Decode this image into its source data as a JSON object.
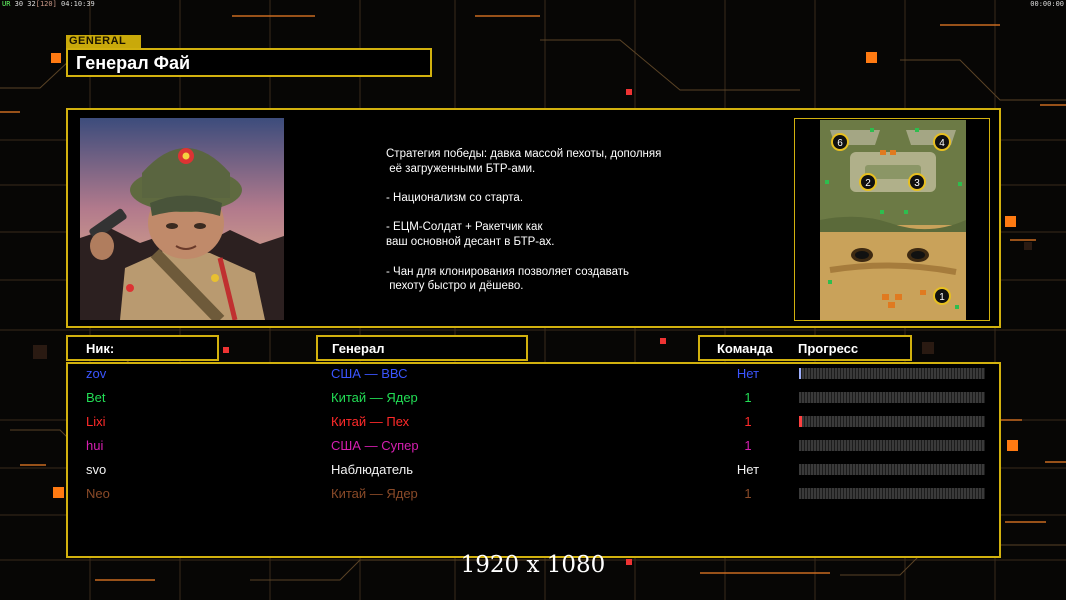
{
  "hud": {
    "left_prefix": "UR",
    "left_fps": "30 32",
    "left_bracket": "[120]",
    "left_time": "04:10:39",
    "right_time": "00:00:00"
  },
  "general": {
    "tag": "GENERAL",
    "name": "Генерал Фай"
  },
  "strategy_lines": [
    "Стратегия победы: давка массой пехоты, дополняя",
    " её загруженными БТР-ами.",
    "",
    "- Национализм со старта.",
    "",
    "- ЕЦМ-Солдат + Ракетчик как",
    "ваш основной десант в БТР-ах.",
    "",
    "- Чан для клонирования позволяет создавать",
    " пехоту быстро и дёшево."
  ],
  "minimap": {
    "start_positions": [
      "6",
      "4",
      "2",
      "3",
      "1"
    ]
  },
  "headers": {
    "nick": "Ник:",
    "general": "Генерал",
    "team": "Команда",
    "progress": "Прогресс"
  },
  "players": [
    {
      "nick": "zov",
      "general": "США — ВВС",
      "team": "Нет",
      "color": "#3b55ff",
      "progress": 0.01,
      "progress_color": "#9fb0ff"
    },
    {
      "nick": "Bet",
      "general": "Китай — Ядер",
      "team": "1",
      "color": "#22dd55",
      "progress": 0.0,
      "progress_color": "#22dd55"
    },
    {
      "nick": "Lixi",
      "general": "Китай — Пех",
      "team": "1",
      "color": "#ff2a2a",
      "progress": 0.015,
      "progress_color": "#ff4040"
    },
    {
      "nick": "hui",
      "general": "США — Супер",
      "team": "1",
      "color": "#d51fb0",
      "progress": 0.0,
      "progress_color": "#d51fb0"
    },
    {
      "nick": "svo",
      "general": "Наблюдатель",
      "team": "Нет",
      "color": "#f2f2f2",
      "progress": 0.0,
      "progress_color": "#ffffff"
    },
    {
      "nick": "Neo",
      "general": "Китай — Ядер",
      "team": "1",
      "color": "#8a4a28",
      "progress": 0.0,
      "progress_color": "#8a4a28"
    }
  ],
  "resolution_label": "1920 x 1080",
  "colors": {
    "accent": "#d2b10e",
    "decor_orange": "#ff7a12"
  }
}
